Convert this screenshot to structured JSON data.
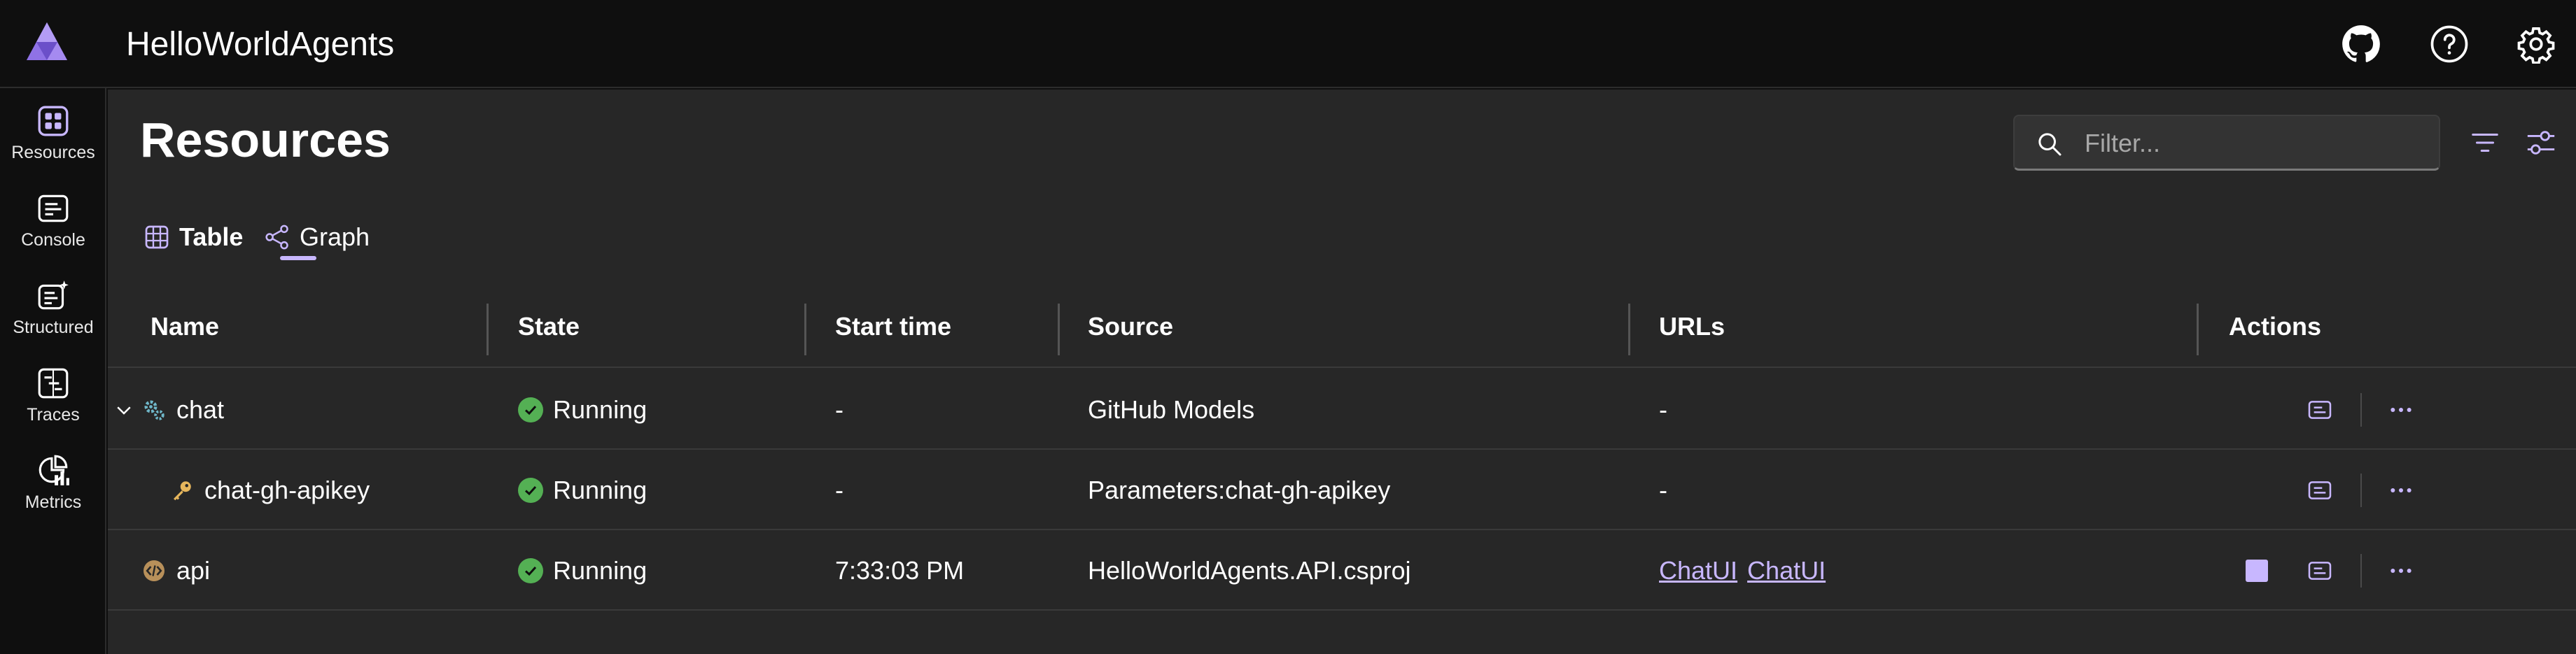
{
  "app": {
    "title": "HelloWorldAgents"
  },
  "header": {
    "icons": [
      "github-icon",
      "help-icon",
      "settings-icon"
    ]
  },
  "nav": {
    "items": [
      {
        "label": "Resources",
        "icon": "resources-icon"
      },
      {
        "label": "Console",
        "icon": "console-icon"
      },
      {
        "label": "Structured",
        "icon": "structured-icon"
      },
      {
        "label": "Traces",
        "icon": "traces-icon"
      },
      {
        "label": "Metrics",
        "icon": "metrics-icon"
      }
    ]
  },
  "page": {
    "title": "Resources",
    "filter_placeholder": "Filter...",
    "tabs": [
      {
        "label": "Table",
        "selected": true
      },
      {
        "label": "Graph",
        "selected": false
      }
    ]
  },
  "table": {
    "columns": [
      "Name",
      "State",
      "Start time",
      "Source",
      "URLs",
      "Actions"
    ],
    "rows": [
      {
        "name": "chat",
        "state": "Running",
        "start": "-",
        "source": "GitHub Models",
        "urls": "-",
        "links": []
      },
      {
        "name": "chat-gh-apikey",
        "state": "Running",
        "start": "-",
        "source": "Parameters:chat-gh-apikey",
        "urls": "-",
        "links": []
      },
      {
        "name": "api",
        "state": "Running",
        "start": "7:33:03 PM",
        "source": "HelloWorldAgents.API.csproj",
        "urls": "",
        "links": [
          "ChatUI",
          "ChatUI"
        ]
      }
    ]
  },
  "colors": {
    "accent": "#c8b7ff",
    "running": "#54b054",
    "background": "#272727",
    "chrome": "#0f0f0f"
  }
}
